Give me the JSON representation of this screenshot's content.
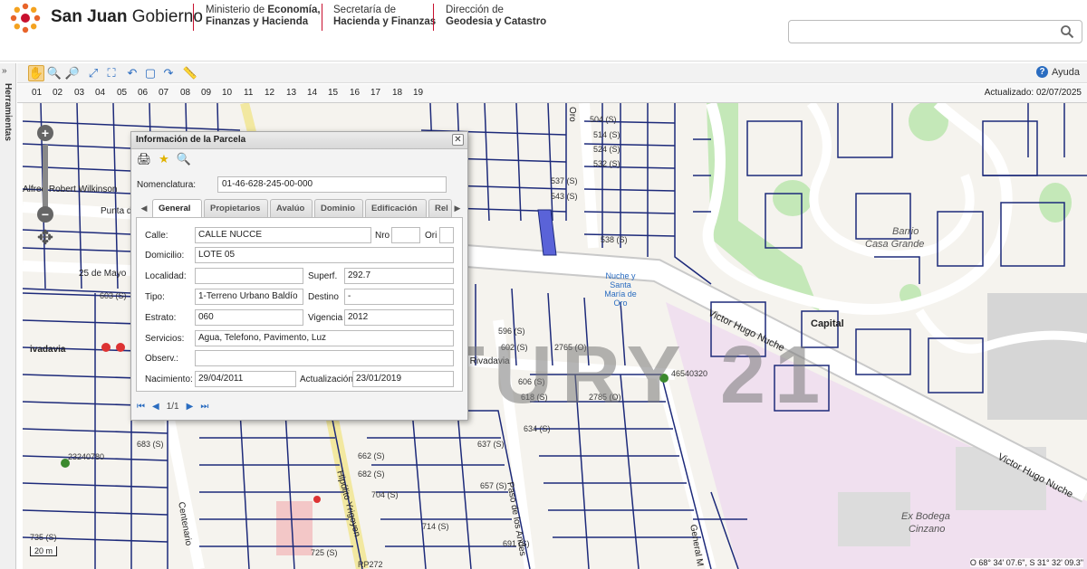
{
  "header": {
    "brand_main": "San Juan",
    "brand_sub": "Gobierno",
    "ministry_line1": "Ministerio de ",
    "ministry_bold1": "Economía,",
    "ministry_line2": "Finanzas y Hacienda",
    "secretaria_line1": "Secretaría de",
    "secretaria_line2": "Hacienda y Finanzas",
    "direccion_line1": "Dirección de",
    "direccion_line2": "Geodesia y Catastro",
    "search_placeholder": ""
  },
  "sidebar": {
    "label": "Herramientas",
    "toggle": "»"
  },
  "toolbar": {
    "help_label": "Ayuda"
  },
  "levels": {
    "items": [
      "01",
      "02",
      "03",
      "04",
      "05",
      "06",
      "07",
      "08",
      "09",
      "10",
      "11",
      "12",
      "13",
      "14",
      "15",
      "16",
      "17",
      "18",
      "19"
    ],
    "updated": "Actualizado: 02/07/2025"
  },
  "map": {
    "watermark": "CENTURY 21",
    "scale": "20 m",
    "coords": "O 68° 34' 07.6\", S 31° 32' 09.3\"",
    "streets": {
      "victor_hugo_1": "Victor Hugo Nuche",
      "victor_hugo_2": "Victor Hugo Nuche",
      "rivadavia": "dino Rivadavia",
      "paso_andes": "Paso de los Andes",
      "centenario": "Centenario",
      "hipolito": "Hipólito Yrigoyen",
      "general": "General M",
      "mayo": "25 de Mayo",
      "wilkinson": "Alfred Robert Wilkinson",
      "punta": "Punta d",
      "oro": "Oro",
      "rivadavia_left": "ivadavia"
    },
    "places": {
      "barrio": "Barrio",
      "casa_grande": "Casa Grande",
      "capital": "Capital",
      "nuche_santa": "Nuche y Santa María de Oro",
      "ex_bodega": "Ex Bodega",
      "cinzano": "Cinzano",
      "point1": "46540320",
      "point2": "23240780",
      "ruta": "RP272"
    },
    "lot_labels": [
      "537 (S)",
      "543 (S)",
      "504 (S)",
      "514 (S)",
      "524 (S)",
      "532 (S)",
      "538 (S)",
      "596 (S)",
      "602 (S)",
      "606 (S)",
      "618 (S)",
      "634 (S)",
      "637 (S)",
      "657 (S)",
      "662 (S)",
      "682 (S)",
      "691 (S)",
      "704 (S)",
      "714 (S)",
      "725 (S)",
      "735 (S)",
      "603 (S)",
      "683 (S)",
      "2765 (O)",
      "2785 (O)"
    ]
  },
  "dialog": {
    "title": "Información de la Parcela",
    "close": "✕",
    "nomenclatura_label": "Nomenclatura:",
    "nomenclatura_value": "01-46-628-245-00-000",
    "tabs": [
      "General",
      "Propietarios",
      "Avalúo",
      "Dominio",
      "Edificación",
      "Rel"
    ],
    "fields": {
      "calle_label": "Calle:",
      "calle_value": "CALLE NUCCE",
      "nro_label": "Nro",
      "nro_value": "",
      "ori_label": "Ori",
      "ori_value": "",
      "domicilio_label": "Domicilio:",
      "domicilio_value": "LOTE 05",
      "localidad_label": "Localidad:",
      "localidad_value": "",
      "superf_label": "Superf.",
      "superf_value": "292.7",
      "tipo_label": "Tipo:",
      "tipo_value": "1-Terreno Urbano Baldío",
      "destino_label": "Destino",
      "destino_value": "-",
      "estrato_label": "Estrato:",
      "estrato_value": "060",
      "vigencia_label": "Vigencia",
      "vigencia_value": "2012",
      "servicios_label": "Servicios:",
      "servicios_value": "Agua, Telefono, Pavimento, Luz",
      "observ_label": "Observ.:",
      "observ_value": "",
      "nacimiento_label": "Nacimiento:",
      "nacimiento_value": "29/04/2011",
      "actualizacion_label": "Actualización:",
      "actualizacion_value": "23/01/2019"
    },
    "pager": "1/1"
  },
  "colors": {
    "lot_border": "#1d2a7a",
    "highlight": "#5a63d8",
    "accent_red": "#c8102e",
    "green_area": "#c4e8b8",
    "pink_area": "#f0e0ef"
  }
}
